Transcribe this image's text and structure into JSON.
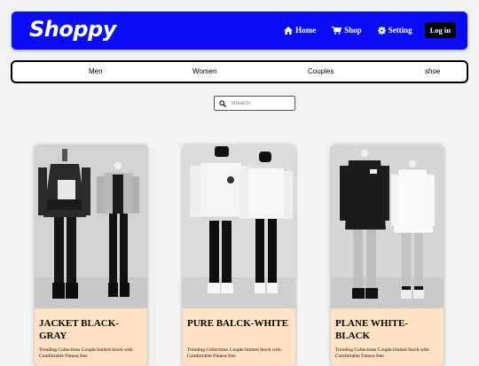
{
  "header": {
    "logo": "Shoppy",
    "nav": [
      {
        "label": "Home",
        "icon": "home-icon"
      },
      {
        "label": "Shop",
        "icon": "cart-icon"
      },
      {
        "label": "Setting",
        "icon": "gear-icon"
      }
    ],
    "login_label": "Log in",
    "background": "#0b0bf5"
  },
  "categories": [
    "Men",
    "Women",
    "Couples",
    "shoe"
  ],
  "search": {
    "placeholder": "Shearch",
    "icon": "search-icon"
  },
  "products": [
    {
      "title": "JACKET BLACK-GRAY",
      "description": "Trending Collections Couple limited Stock with Comfortable Fitness free"
    },
    {
      "title": "PURE BALCK-WHITE",
      "description": "Trending Collections Couple limited Stock with Comfortable Fitness free"
    },
    {
      "title": "PLANE WHITE-BLACK",
      "description": "Trending Collections Couple limited Stock with Comfortable Fitness free"
    }
  ],
  "colors": {
    "card_background": "#ffe2c4",
    "page_background": "#f2f2f2"
  }
}
